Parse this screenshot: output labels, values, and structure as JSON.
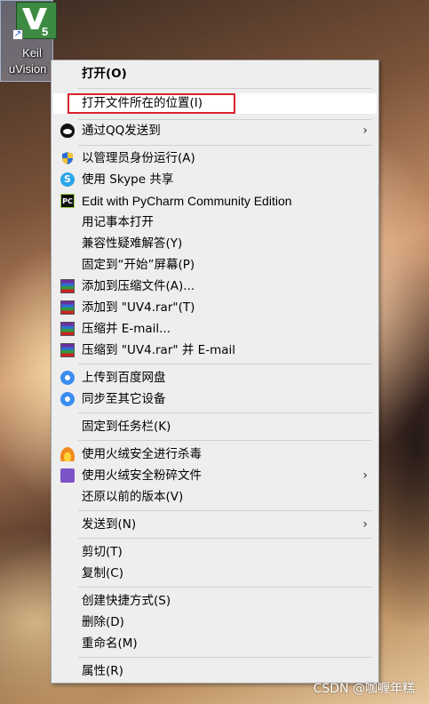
{
  "desktop": {
    "shortcut": {
      "label_line1": "Keil",
      "label_line2": "uVision",
      "icon": "keil-uvision5-logo",
      "logo_text": "5"
    }
  },
  "menu": {
    "items": [
      {
        "label": "打开(O)",
        "icon": null,
        "bold": true
      },
      {
        "label": "打开文件所在的位置(I)",
        "icon": null,
        "highlighted": true
      },
      {
        "label": "通过QQ发送到",
        "icon": "qq-icon",
        "submenu": true
      },
      {
        "label": "以管理员身份运行(A)",
        "icon": "uac-shield-icon"
      },
      {
        "label": "使用 Skype 共享",
        "icon": "skype-icon"
      },
      {
        "label": "Edit with PyCharm Community Edition",
        "icon": "pycharm-icon"
      },
      {
        "label": "用记事本打开",
        "icon": null
      },
      {
        "label": "兼容性疑难解答(Y)",
        "icon": null
      },
      {
        "label": "固定到“开始”屏幕(P)",
        "icon": null
      },
      {
        "label": "添加到压缩文件(A)...",
        "icon": "winrar-icon"
      },
      {
        "label": "添加到 \"UV4.rar\"(T)",
        "icon": "winrar-icon"
      },
      {
        "label": "压缩并 E-mail...",
        "icon": "winrar-icon"
      },
      {
        "label": "压缩到 \"UV4.rar\" 并 E-mail",
        "icon": "winrar-icon"
      },
      {
        "label": "上传到百度网盘",
        "icon": "baidu-netdisk-icon"
      },
      {
        "label": "同步至其它设备",
        "icon": "baidu-netdisk-icon"
      },
      {
        "label": "固定到任务栏(K)",
        "icon": null
      },
      {
        "label": "使用火绒安全进行杀毒",
        "icon": "huorong-icon"
      },
      {
        "label": "使用火绒安全粉碎文件",
        "icon": "huorong-shred-icon",
        "submenu": true
      },
      {
        "label": "还原以前的版本(V)",
        "icon": null
      },
      {
        "label": "发送到(N)",
        "icon": null,
        "submenu": true
      },
      {
        "label": "剪切(T)",
        "icon": null
      },
      {
        "label": "复制(C)",
        "icon": null
      },
      {
        "label": "创建快捷方式(S)",
        "icon": null
      },
      {
        "label": "删除(D)",
        "icon": null
      },
      {
        "label": "重命名(M)",
        "icon": null
      },
      {
        "label": "属性(R)",
        "icon": null
      }
    ],
    "submenu_arrow": "›"
  },
  "watermark": "CSDN @咖喱年糕",
  "colors": {
    "menu_bg": "#eeeeee",
    "highlight_border": "#d9232d",
    "separator": "#cfcfcf"
  }
}
